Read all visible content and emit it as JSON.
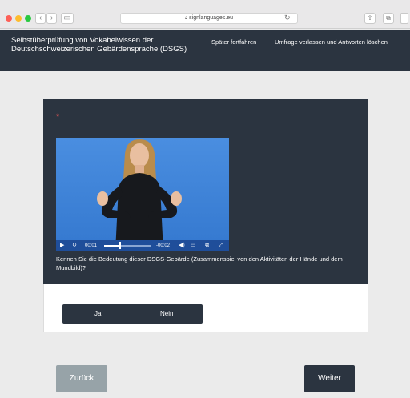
{
  "browser": {
    "url": "signlanguages.eu",
    "icons": [
      "back-icon",
      "forward-icon",
      "sidebar-icon",
      "lock-icon",
      "reload-icon",
      "share-icon",
      "tabs-icon"
    ]
  },
  "header": {
    "title": "Selbstüberprüfung von Vokabelwissen der Deutschschweizerischen Gebärdensprache (DSGS)",
    "later_link": "Später fortfahren",
    "quit_link": "Umfrage verlassen und Antworten löschen"
  },
  "question": {
    "required_mark": "*",
    "text": "Kennen Sie die Bedeutung dieser DSGS-Gebärde (Zusammenspiel von den Aktivitäten der Hände und dem Mundbild)?",
    "video": {
      "current_time": "00:01",
      "remaining_time": "-00:02",
      "progress": 0.33
    },
    "answers": [
      "Ja",
      "Nein"
    ]
  },
  "nav": {
    "back_label": "Zurück",
    "next_label": "Weiter"
  }
}
